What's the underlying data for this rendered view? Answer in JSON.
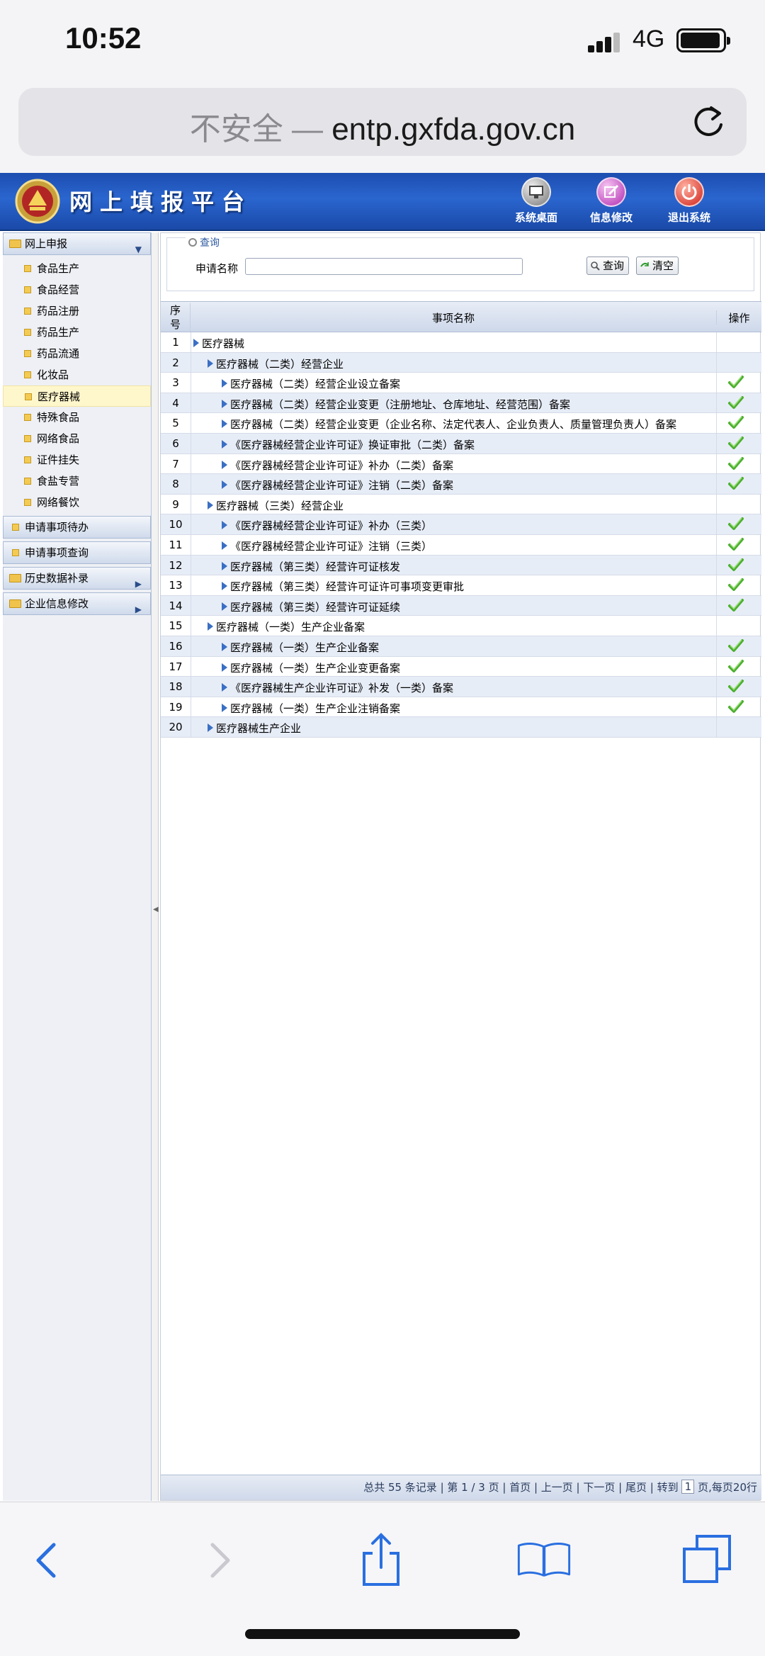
{
  "status": {
    "time": "10:52",
    "network": "4G"
  },
  "browser": {
    "insecure_label": "不安全 —",
    "domain": "entp.gxfda.gov.cn"
  },
  "banner": {
    "title": "网上填报平台",
    "buttons": [
      "系统桌面",
      "信息修改",
      "退出系统"
    ]
  },
  "sidebar": {
    "sections": [
      {
        "label": "网上申报",
        "items": [
          "食品生产",
          "食品经营",
          "药品注册",
          "药品生产",
          "药品流通",
          "化妆品",
          "医疗器械",
          "特殊食品",
          "网络食品",
          "证件挂失",
          "食盐专营",
          "网络餐饮"
        ],
        "active": "医疗器械"
      },
      {
        "label": "申请事项待办"
      },
      {
        "label": "申请事项查询"
      },
      {
        "label": "历史数据补录"
      },
      {
        "label": "企业信息修改"
      }
    ]
  },
  "query": {
    "legend": "查询",
    "field_label": "申请名称",
    "field_value": "",
    "search_btn": "查询",
    "clear_btn": "清空"
  },
  "table": {
    "headers": {
      "seq": "序号",
      "seq_top": "序",
      "seq_bottom": "号",
      "name": "事项名称",
      "op": "操作"
    },
    "rows": [
      {
        "seq": "1",
        "level": 0,
        "name": "医疗器械",
        "op": false
      },
      {
        "seq": "2",
        "level": 1,
        "name": "医疗器械（二类）经营企业",
        "op": false
      },
      {
        "seq": "3",
        "level": 2,
        "name": "医疗器械（二类）经营企业设立备案",
        "op": true
      },
      {
        "seq": "4",
        "level": 2,
        "name": "医疗器械（二类）经营企业变更（注册地址、仓库地址、经营范围）备案",
        "op": true
      },
      {
        "seq": "5",
        "level": 2,
        "name": "医疗器械（二类）经营企业变更（企业名称、法定代表人、企业负责人、质量管理负责人）备案",
        "op": true
      },
      {
        "seq": "6",
        "level": 2,
        "name": "《医疗器械经营企业许可证》换证审批（二类）备案",
        "op": true
      },
      {
        "seq": "7",
        "level": 2,
        "name": "《医疗器械经营企业许可证》补办（二类）备案",
        "op": true
      },
      {
        "seq": "8",
        "level": 2,
        "name": "《医疗器械经营企业许可证》注销（二类）备案",
        "op": true
      },
      {
        "seq": "9",
        "level": 1,
        "name": "医疗器械（三类）经营企业",
        "op": false
      },
      {
        "seq": "10",
        "level": 2,
        "name": "《医疗器械经营企业许可证》补办（三类）",
        "op": true
      },
      {
        "seq": "11",
        "level": 2,
        "name": "《医疗器械经营企业许可证》注销（三类）",
        "op": true
      },
      {
        "seq": "12",
        "level": 2,
        "name": "医疗器械（第三类）经营许可证核发",
        "op": true
      },
      {
        "seq": "13",
        "level": 2,
        "name": "医疗器械（第三类）经营许可证许可事项变更审批",
        "op": true
      },
      {
        "seq": "14",
        "level": 2,
        "name": "医疗器械（第三类）经营许可证延续",
        "op": true
      },
      {
        "seq": "15",
        "level": 1,
        "name": "医疗器械（一类）生产企业备案",
        "op": false
      },
      {
        "seq": "16",
        "level": 2,
        "name": "医疗器械（一类）生产企业备案",
        "op": true
      },
      {
        "seq": "17",
        "level": 2,
        "name": "医疗器械（一类）生产企业变更备案",
        "op": true
      },
      {
        "seq": "18",
        "level": 2,
        "name": "《医疗器械生产企业许可证》补发（一类）备案",
        "op": true
      },
      {
        "seq": "19",
        "level": 2,
        "name": "医疗器械（一类）生产企业注销备案",
        "op": true
      },
      {
        "seq": "20",
        "level": 1,
        "name": "医疗器械生产企业",
        "op": false
      }
    ]
  },
  "pager": {
    "summary": "总共 55 条记录 | 第 1 / 3 页 | 首页 | 上一页 | 下一页 | 尾页 | 转到",
    "page_value": "1",
    "suffix": "页,每页20行"
  },
  "colors": {
    "banner": "#2a66cf",
    "row_alt": "#e7edf7",
    "check": "#4caf2f",
    "tree_arrow": "#3a6fc4"
  }
}
